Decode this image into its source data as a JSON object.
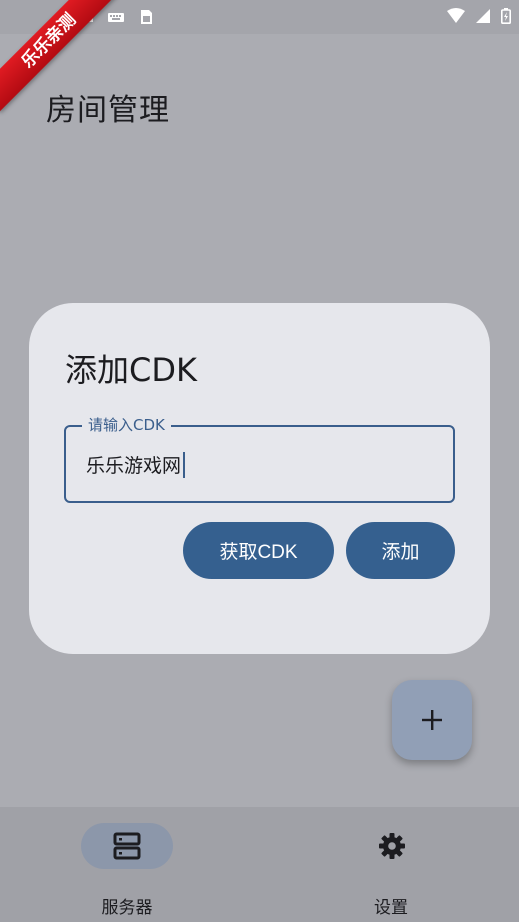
{
  "ribbon": {
    "text": "乐乐亲测"
  },
  "page": {
    "title": "房间管理"
  },
  "dialog": {
    "title": "添加CDK",
    "input": {
      "label": "请输入CDK",
      "value": "乐乐游戏网"
    },
    "buttons": {
      "get_cdk": "获取CDK",
      "add": "添加"
    }
  },
  "fab": {
    "icon": "plus-icon"
  },
  "bottom_nav": {
    "items": [
      {
        "label": "服务器",
        "icon": "server-icon",
        "selected": true
      },
      {
        "label": "设置",
        "icon": "gear-icon",
        "selected": false
      }
    ]
  },
  "colors": {
    "accent": "#35608f",
    "dialog_bg": "#e6e7ec",
    "scrim": "#abacb2",
    "ribbon": "#d4141b"
  }
}
